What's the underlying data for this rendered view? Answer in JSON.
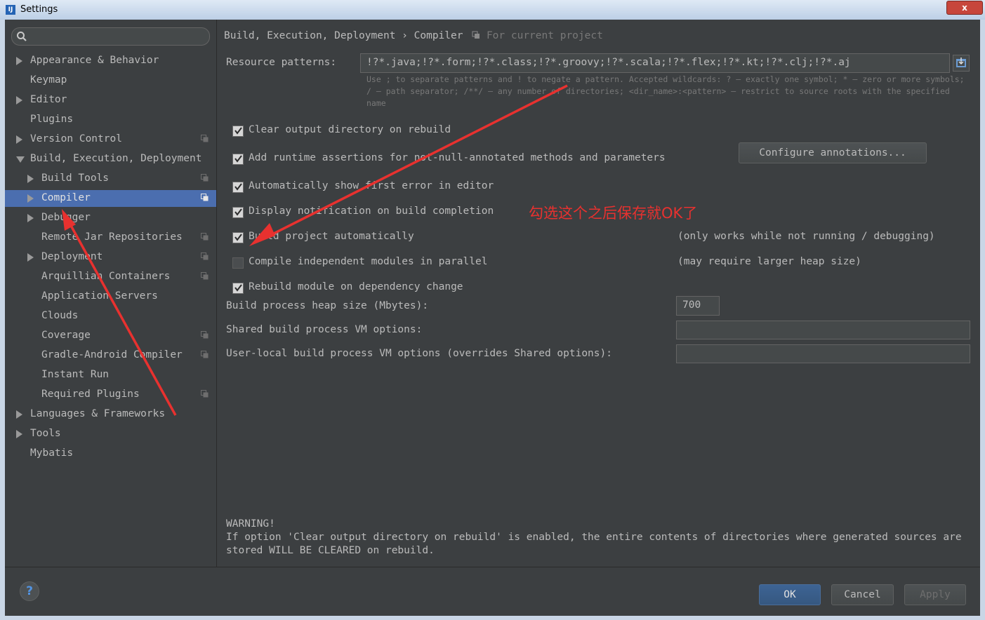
{
  "window": {
    "title": "Settings",
    "close_label": "x",
    "app_icon_label": "IJ"
  },
  "search": {
    "placeholder": ""
  },
  "sidebar": {
    "items": [
      {
        "label": "Appearance & Behavior",
        "arrow": "right",
        "indent": 0,
        "proj": false
      },
      {
        "label": "Keymap",
        "arrow": "",
        "indent": 0,
        "proj": false
      },
      {
        "label": "Editor",
        "arrow": "right",
        "indent": 0,
        "proj": false
      },
      {
        "label": "Plugins",
        "arrow": "",
        "indent": 0,
        "proj": false
      },
      {
        "label": "Version Control",
        "arrow": "right",
        "indent": 0,
        "proj": true
      },
      {
        "label": "Build, Execution, Deployment",
        "arrow": "down",
        "indent": 0,
        "proj": false
      },
      {
        "label": "Build Tools",
        "arrow": "right",
        "indent": 1,
        "proj": true
      },
      {
        "label": "Compiler",
        "arrow": "right",
        "indent": 1,
        "proj": true,
        "selected": true
      },
      {
        "label": "Debugger",
        "arrow": "right",
        "indent": 1,
        "proj": false
      },
      {
        "label": "Remote Jar Repositories",
        "arrow": "",
        "indent": 1,
        "proj": true
      },
      {
        "label": "Deployment",
        "arrow": "right",
        "indent": 1,
        "proj": true
      },
      {
        "label": "Arquillian Containers",
        "arrow": "",
        "indent": 1,
        "proj": true
      },
      {
        "label": "Application Servers",
        "arrow": "",
        "indent": 1,
        "proj": false
      },
      {
        "label": "Clouds",
        "arrow": "",
        "indent": 1,
        "proj": false
      },
      {
        "label": "Coverage",
        "arrow": "",
        "indent": 1,
        "proj": true
      },
      {
        "label": "Gradle-Android Compiler",
        "arrow": "",
        "indent": 1,
        "proj": true
      },
      {
        "label": "Instant Run",
        "arrow": "",
        "indent": 1,
        "proj": false
      },
      {
        "label": "Required Plugins",
        "arrow": "",
        "indent": 1,
        "proj": true
      },
      {
        "label": "Languages & Frameworks",
        "arrow": "right",
        "indent": 0,
        "proj": false
      },
      {
        "label": "Tools",
        "arrow": "right",
        "indent": 0,
        "proj": false
      },
      {
        "label": "Mybatis",
        "arrow": "",
        "indent": 0,
        "proj": false
      }
    ]
  },
  "breadcrumb": {
    "path": "Build, Execution, Deployment",
    "separator": "›",
    "page": "Compiler",
    "scope": "For current project"
  },
  "resource": {
    "label": "Resource patterns:",
    "value": "!?*.java;!?*.form;!?*.class;!?*.groovy;!?*.scala;!?*.flex;!?*.kt;!?*.clj;!?*.aj",
    "hint": "Use ; to separate patterns and ! to negate a pattern. Accepted wildcards: ? — exactly one symbol; * — zero or more symbols; / — path separator; /**/ — any number of directories; <dir_name>:<pattern> — restrict to source roots with the specified name"
  },
  "options": [
    {
      "label": "Clear output directory on rebuild",
      "checked": true
    },
    {
      "label": "Add runtime assertions for not-null-annotated methods and parameters",
      "checked": true
    },
    {
      "label": "Automatically show first error in editor",
      "checked": true
    },
    {
      "label": "Display notification on build completion",
      "checked": true
    },
    {
      "label": "Build project automatically",
      "checked": true,
      "note": "(only works while not running / debugging)"
    },
    {
      "label": "Compile independent modules in parallel",
      "checked": false,
      "note": "(may require larger heap size)"
    },
    {
      "label": "Rebuild module on dependency change",
      "checked": true
    }
  ],
  "configure_button": "Configure annotations...",
  "heap": {
    "label": "Build process heap size (Mbytes):",
    "value": "700"
  },
  "shared_vm": {
    "label": "Shared build process VM options:",
    "value": ""
  },
  "user_vm": {
    "label": "User-local build process VM options (overrides Shared options):",
    "value": ""
  },
  "warning": {
    "title": "WARNING!",
    "text": "If option 'Clear output directory on rebuild' is enabled, the entire contents of directories where generated sources are stored WILL BE CLEARED on rebuild."
  },
  "annotation": {
    "text": "勾选这个之后保存就OK了",
    "color": "#e8312f"
  },
  "footer": {
    "ok": "OK",
    "cancel": "Cancel",
    "apply": "Apply",
    "help": "?"
  },
  "colors": {
    "selection": "#4b6eaf",
    "panel": "#3c3f41",
    "text": "#bbbbbb",
    "ok_button": "#365880"
  }
}
